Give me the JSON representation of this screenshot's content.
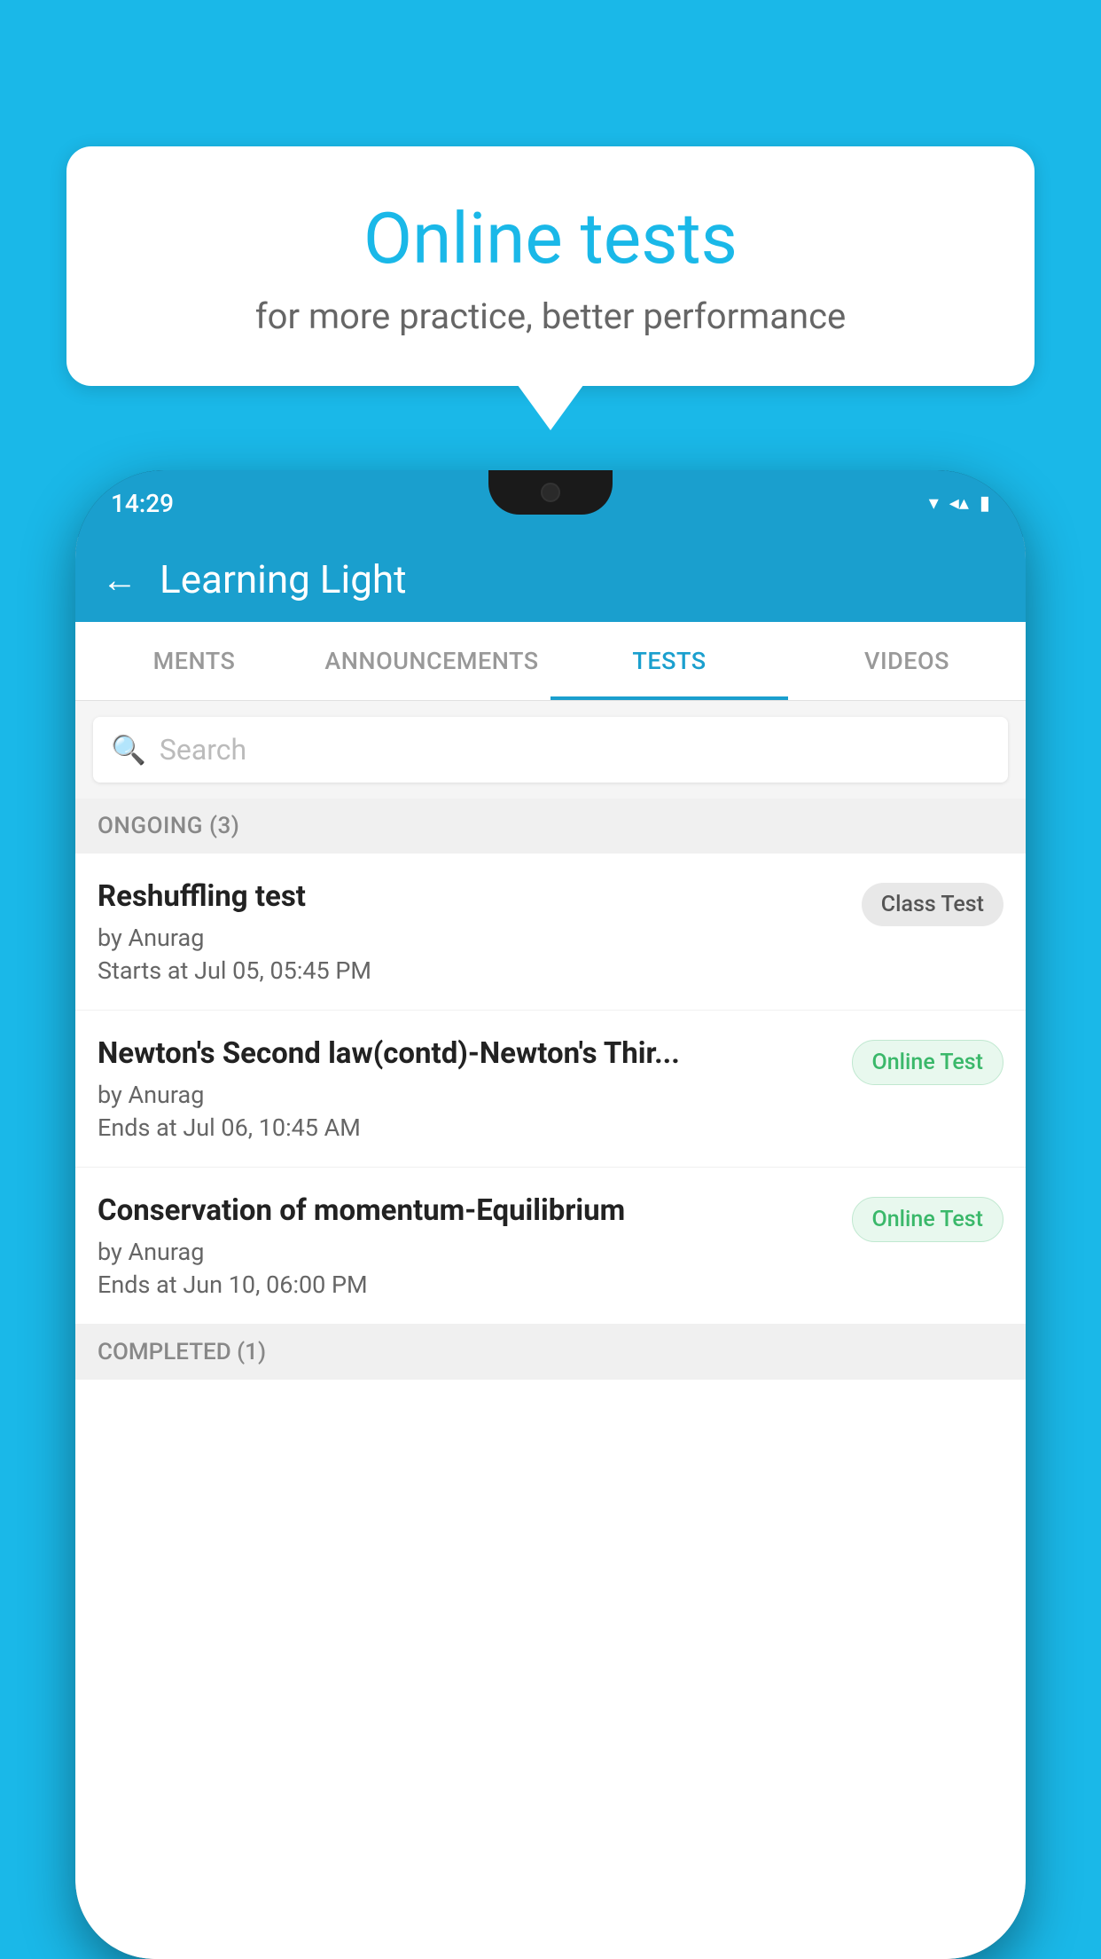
{
  "background": {
    "color": "#1ab8e8"
  },
  "bubble": {
    "title": "Online tests",
    "subtitle": "for more practice, better performance"
  },
  "phone": {
    "status_time": "14:29",
    "header": {
      "app_name": "Learning Light",
      "back_label": "←"
    },
    "tabs": [
      {
        "label": "MENTS",
        "active": false
      },
      {
        "label": "ANNOUNCEMENTS",
        "active": false
      },
      {
        "label": "TESTS",
        "active": true
      },
      {
        "label": "VIDEOS",
        "active": false
      }
    ],
    "search": {
      "placeholder": "Search"
    },
    "ongoing_section": {
      "label": "ONGOING (3)"
    },
    "tests": [
      {
        "name": "Reshuffling test",
        "by": "by Anurag",
        "date_label": "Starts at",
        "date": "Jul 05, 05:45 PM",
        "badge": "Class Test",
        "badge_type": "class"
      },
      {
        "name": "Newton's Second law(contd)-Newton's Thir...",
        "by": "by Anurag",
        "date_label": "Ends at",
        "date": "Jul 06, 10:45 AM",
        "badge": "Online Test",
        "badge_type": "online"
      },
      {
        "name": "Conservation of momentum-Equilibrium",
        "by": "by Anurag",
        "date_label": "Ends at",
        "date": "Jun 10, 06:00 PM",
        "badge": "Online Test",
        "badge_type": "online"
      }
    ],
    "completed_section": {
      "label": "COMPLETED (1)"
    }
  }
}
